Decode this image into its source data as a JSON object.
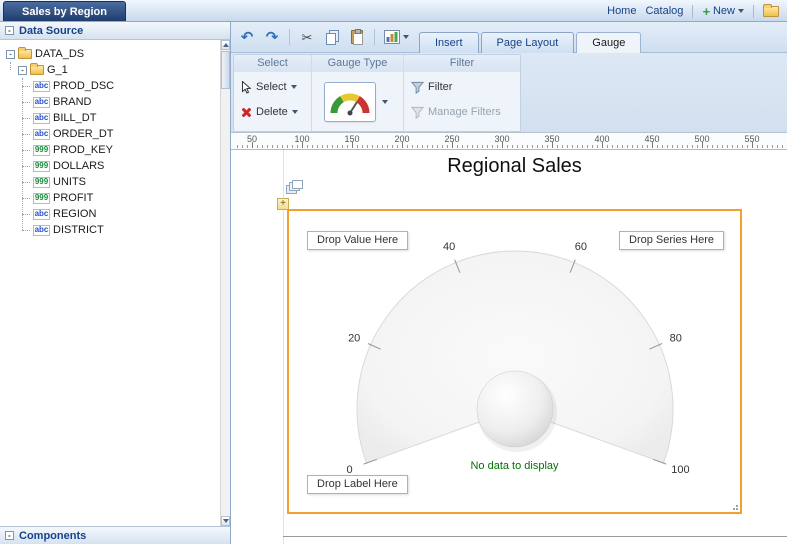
{
  "topbar": {
    "document_tab": "Sales by Region",
    "home": "Home",
    "catalog": "Catalog",
    "new_label": "New"
  },
  "sidebar": {
    "data_source_header": "Data Source",
    "components_header": "Components",
    "tree": {
      "root_label": "DATA_DS",
      "group_label": "G_1",
      "fields": [
        {
          "label": "PROD_DSC",
          "type": "abc"
        },
        {
          "label": "BRAND",
          "type": "abc"
        },
        {
          "label": "BILL_DT",
          "type": "abc"
        },
        {
          "label": "ORDER_DT",
          "type": "abc"
        },
        {
          "label": "PROD_KEY",
          "type": "999"
        },
        {
          "label": "DOLLARS",
          "type": "999"
        },
        {
          "label": "UNITS",
          "type": "999"
        },
        {
          "label": "PROFIT",
          "type": "999"
        },
        {
          "label": "REGION",
          "type": "abc"
        },
        {
          "label": "DISTRICT",
          "type": "abc"
        }
      ]
    }
  },
  "ribbon": {
    "tabs": [
      {
        "label": "Insert"
      },
      {
        "label": "Page Layout"
      },
      {
        "label": "Gauge"
      }
    ],
    "select_group": {
      "title": "Select",
      "select": "Select",
      "delete": "Delete"
    },
    "gauge_type_group": {
      "title": "Gauge Type"
    },
    "filter_group": {
      "title": "Filter",
      "filter": "Filter",
      "manage_filters": "Manage Filters"
    }
  },
  "ruler": {
    "labels": [
      "50",
      "100",
      "150",
      "200",
      "250",
      "300",
      "350",
      "400",
      "450",
      "500",
      "550"
    ]
  },
  "canvas": {
    "title": "Regional Sales",
    "drop_value": "Drop Value Here",
    "drop_series": "Drop Series Here",
    "drop_label": "Drop Label Here",
    "no_data": "No data to display",
    "gauge_ticks": [
      0,
      20,
      40,
      60,
      80,
      100
    ],
    "accent_color": "#f1a22d",
    "no_data_color": "#067006"
  }
}
